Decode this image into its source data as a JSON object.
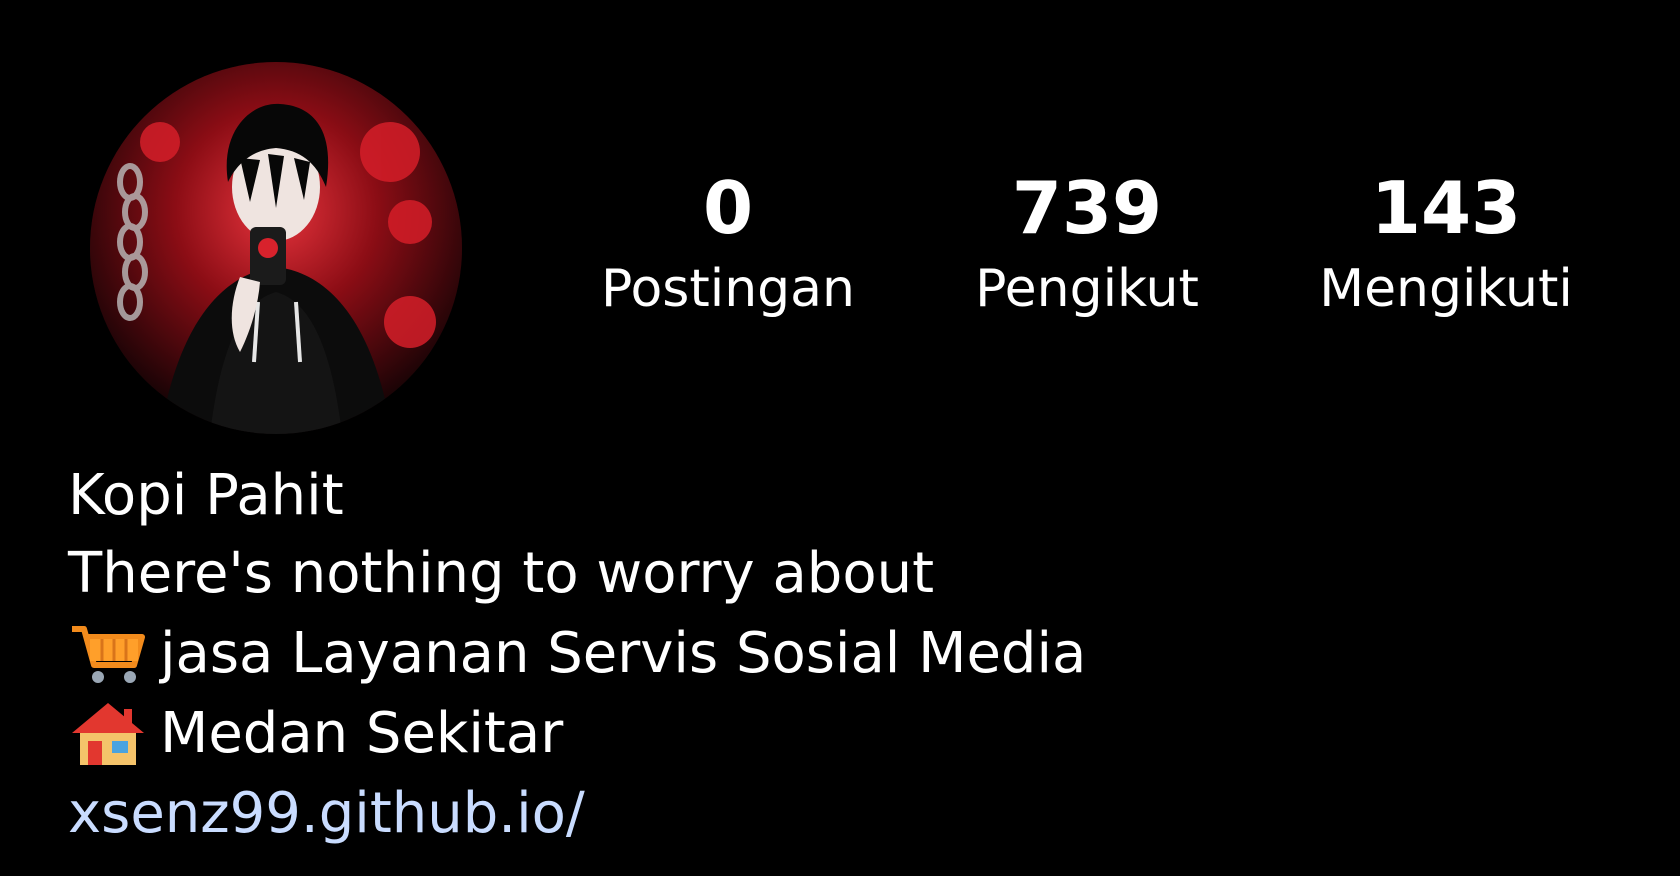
{
  "profile": {
    "avatar_alt": "profile-avatar",
    "stats": {
      "posts": {
        "value": "0",
        "label": "Postingan"
      },
      "followers": {
        "value": "739",
        "label": "Pengikut"
      },
      "following": {
        "value": "143",
        "label": "Mengikuti"
      }
    },
    "bio": {
      "name": "Kopi Pahit",
      "tagline": "There's nothing to worry about",
      "service_icon": "shopping-cart-icon",
      "service": "jasa Layanan Servis Sosial Media",
      "location_icon": "house-icon",
      "location": "Medan Sekitar",
      "website": "xsenz99.github.io/"
    }
  },
  "colors": {
    "background": "#000000",
    "text": "#ffffff",
    "link": "#c9dcff",
    "avatar_accent": "#c0101c"
  }
}
